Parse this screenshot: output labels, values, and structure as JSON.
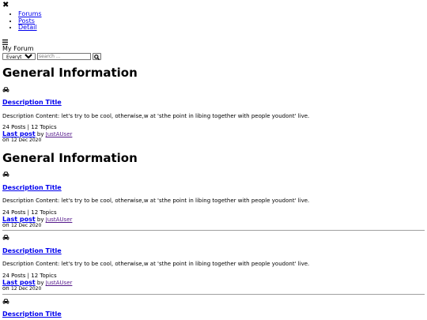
{
  "nav": {
    "items": [
      {
        "label": "Forums"
      },
      {
        "label": "Posts"
      },
      {
        "label": "Detail"
      }
    ]
  },
  "header": {
    "brand": "My Forum",
    "search": {
      "scope_selected": "Everything",
      "placeholder": "search ..."
    }
  },
  "sections": [
    {
      "heading": "General Information"
    },
    {
      "heading": "General Information"
    }
  ],
  "topic": {
    "title": "Description Title",
    "content": "Description Content: let's try to be cool, otherwise,w at 'sthe point in libing together with people youdont' live.",
    "stats": "24 Posts | 12 Topics",
    "last_post_label": "Last post",
    "by": "by",
    "user": "JustAUser",
    "on": "on",
    "date": "12 Dec 2020"
  },
  "icons": {
    "close": "close-icon",
    "menu": "menu-icon",
    "search": "search-icon",
    "category": "car-icon"
  }
}
